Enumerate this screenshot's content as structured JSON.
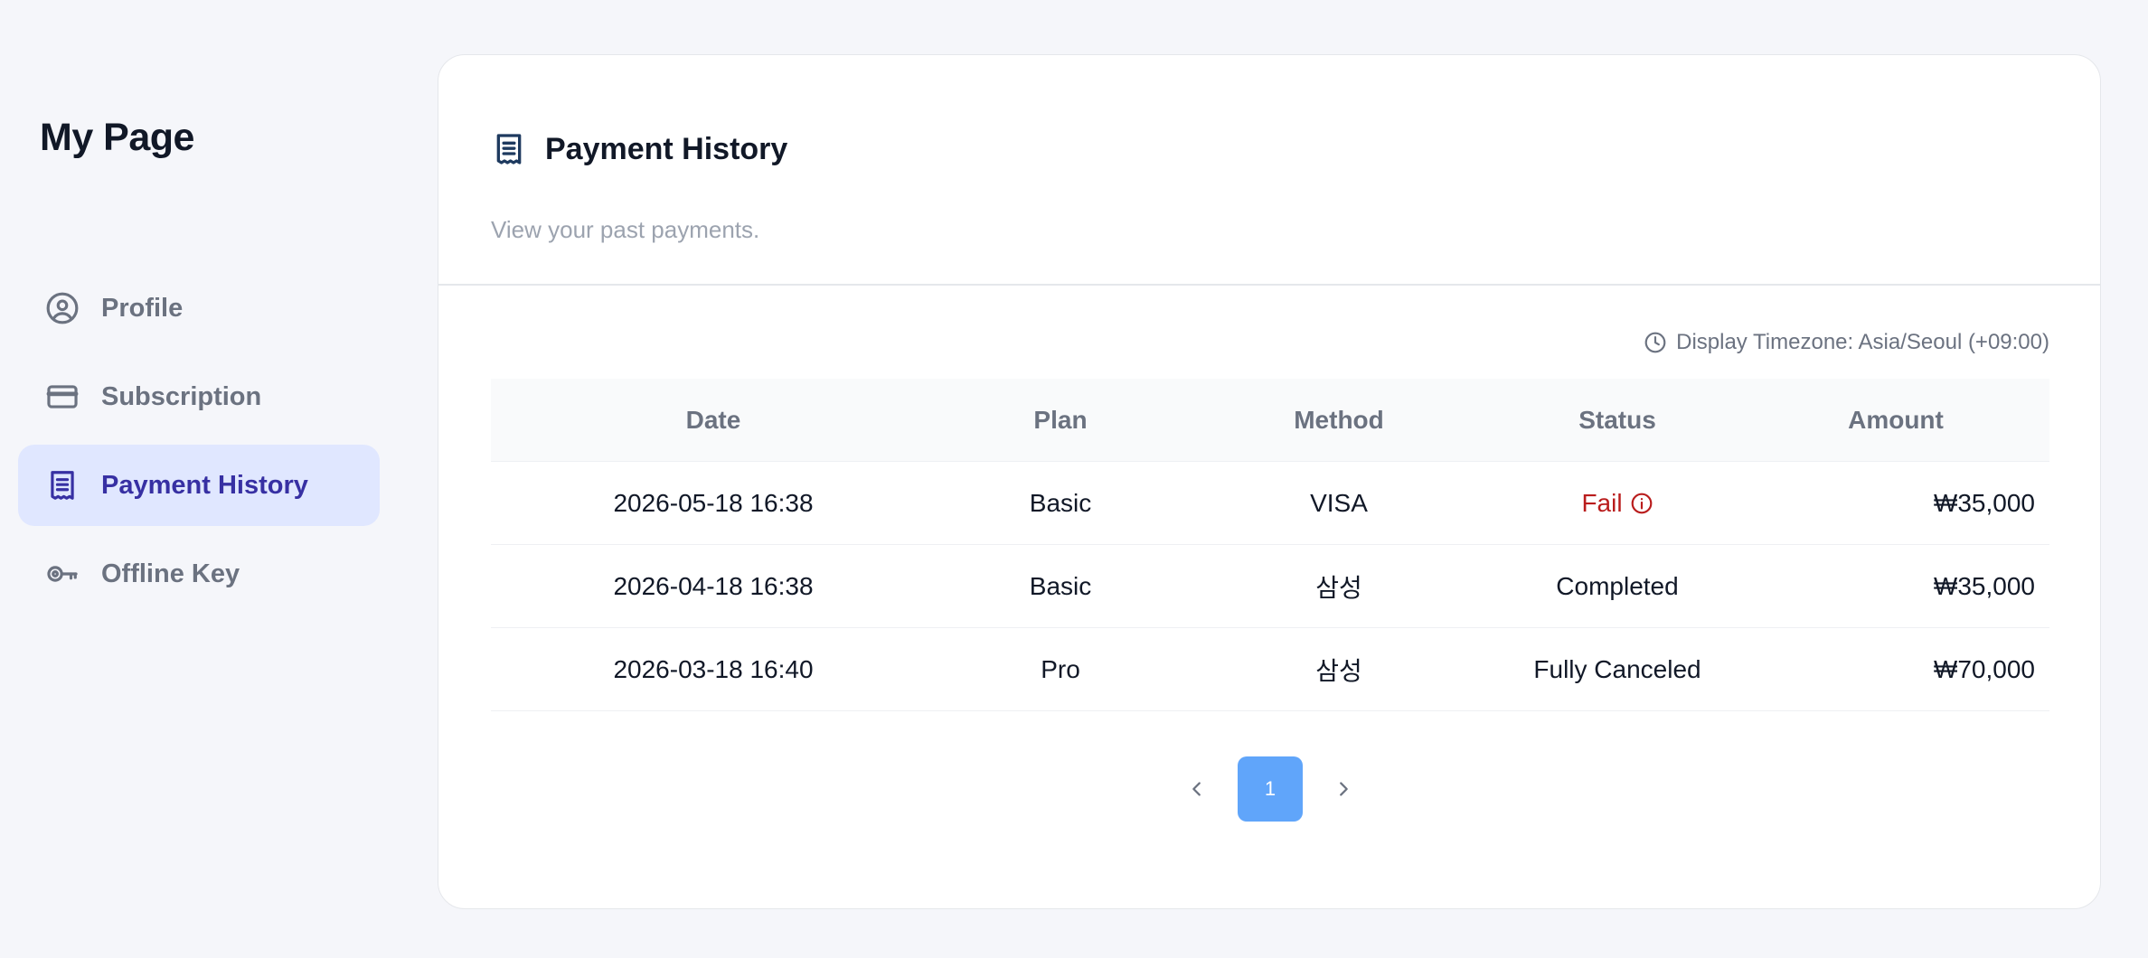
{
  "sidebar": {
    "title": "My Page",
    "items": [
      {
        "label": "Profile",
        "icon": "user-circle-icon",
        "active": false
      },
      {
        "label": "Subscription",
        "icon": "credit-card-icon",
        "active": false
      },
      {
        "label": "Payment History",
        "icon": "receipt-icon",
        "active": true
      },
      {
        "label": "Offline Key",
        "icon": "key-icon",
        "active": false
      }
    ]
  },
  "main": {
    "title": "Payment History",
    "subtitle": "View your past payments.",
    "timezone": "Display Timezone: Asia/Seoul (+09:00)",
    "table": {
      "headers": {
        "date": "Date",
        "plan": "Plan",
        "method": "Method",
        "status": "Status",
        "amount": "Amount"
      },
      "rows": [
        {
          "date": "2026-05-18 16:38",
          "plan": "Basic",
          "method": "VISA",
          "status": "Fail",
          "amount": "₩35,000"
        },
        {
          "date": "2026-04-18 16:38",
          "plan": "Basic",
          "method": "삼성",
          "status": "Completed",
          "amount": "₩35,000"
        },
        {
          "date": "2026-03-18 16:40",
          "plan": "Pro",
          "method": "삼성",
          "status": "Fully Canceled",
          "amount": "₩70,000"
        }
      ]
    },
    "pagination": {
      "current_page": "1"
    }
  },
  "colors": {
    "accent": "#3730a3",
    "active_bg": "#e0e7ff",
    "fail": "#b91c1c",
    "page_button": "#60a5fa"
  }
}
